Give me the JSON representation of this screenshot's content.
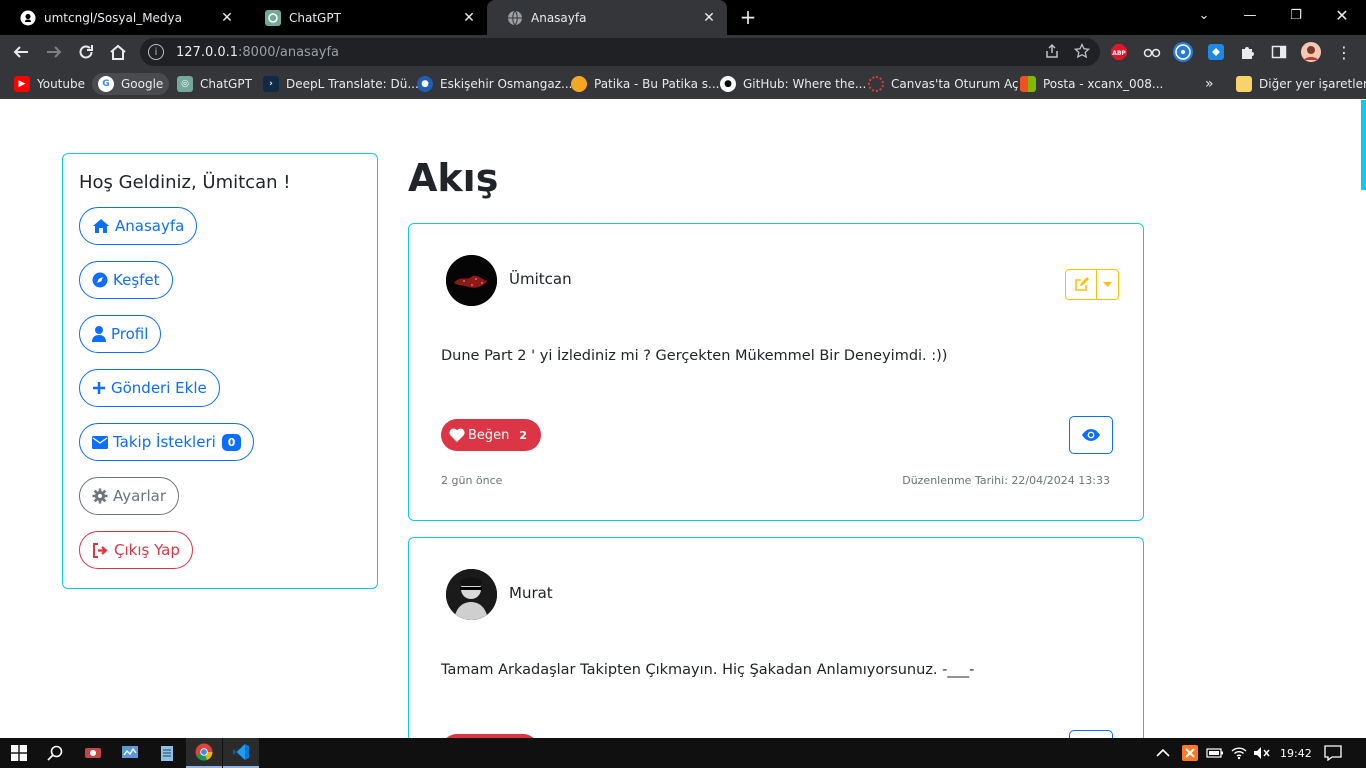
{
  "browser": {
    "tabs": [
      {
        "label": "umtcngl/Sosyal_Medya",
        "icon": "github-icon",
        "active": false
      },
      {
        "label": "ChatGPT",
        "icon": "chatgpt-icon",
        "active": false
      },
      {
        "label": "Anasayfa",
        "icon": "globe-icon",
        "active": true
      }
    ],
    "url_host": "127.0.0.1",
    "url_rest": ":8000/anasayfa",
    "bookmarks": [
      {
        "label": "Youtube",
        "color": "#ff0000"
      },
      {
        "label": "Google",
        "color": "#4285f4"
      },
      {
        "label": "ChatGPT",
        "color": "#74aa9c"
      },
      {
        "label": "DeepL Translate: Dü...",
        "color": "#0f2b46"
      },
      {
        "label": "Eskişehir Osmangaz...",
        "color": "#1e5fb4"
      },
      {
        "label": "Patika - Bu Patika s...",
        "color": "#f5a623"
      },
      {
        "label": "GitHub: Where the...",
        "color": "#ffffff"
      },
      {
        "label": "Canvas'ta Oturum Aç",
        "color": "#e13c3c"
      },
      {
        "label": "Posta - xcanx_008...",
        "color": "#0078d4"
      }
    ],
    "bookmarks_more": "»",
    "other_bookmarks": "Diğer yer işaretleri"
  },
  "sidebar": {
    "welcome": "Hoş Geldiniz, Ümitcan !",
    "items": [
      {
        "label": "Anasayfa",
        "icon": "home-icon"
      },
      {
        "label": "Keşfet",
        "icon": "compass-icon"
      },
      {
        "label": "Profil",
        "icon": "user-icon"
      },
      {
        "label": "Gönderi Ekle",
        "icon": "plus-icon"
      },
      {
        "label": "Takip İstekleri",
        "icon": "envelope-icon",
        "badge": "0"
      },
      {
        "label": "Ayarlar",
        "icon": "gear-icon"
      },
      {
        "label": "Çıkış Yap",
        "icon": "sign-out-icon"
      }
    ]
  },
  "feed": {
    "title": "Akış",
    "posts": [
      {
        "user": "Ümitcan",
        "content": "Dune Part 2 ' yi İzlediniz mi ? Gerçekten Mükemmel Bir Deneyimdi. :))",
        "like_label": "Beğen",
        "like_count": "2",
        "ago": "2 gün önce",
        "edited": "Düzenlenme Tarihi: 22/04/2024 13:33"
      },
      {
        "user": "Murat",
        "content": "Tamam Arkadaşlar Takipten Çıkmayın. Hiç Şakadan Anlamıyorsunuz. -___-"
      }
    ]
  },
  "taskbar": {
    "time": "19:42"
  },
  "colors": {
    "primary": "#0d6efd",
    "info": "#0dcaf0",
    "danger": "#dc3545",
    "warning": "#ffc107",
    "secondary": "#6c757d"
  }
}
